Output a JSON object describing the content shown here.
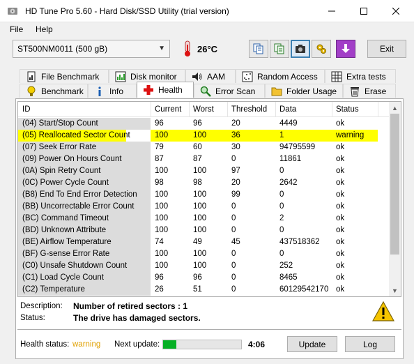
{
  "window": {
    "title": "HD Tune Pro 5.60 - Hard Disk/SSD Utility (trial version)"
  },
  "menu": {
    "file": "File",
    "help": "Help"
  },
  "toolbar": {
    "drive": "ST500NM0011 (500 gB)",
    "temperature": "26°C",
    "exit_label": "Exit",
    "icons": [
      "copy-info-icon",
      "copy-text-icon",
      "screenshot-icon",
      "options-icon",
      "download-icon"
    ]
  },
  "tabs_top": [
    {
      "label": "File Benchmark",
      "icon": "file-benchmark-icon"
    },
    {
      "label": "Disk monitor",
      "icon": "disk-monitor-icon"
    },
    {
      "label": "AAM",
      "icon": "speaker-icon"
    },
    {
      "label": "Random Access",
      "icon": "random-access-icon"
    },
    {
      "label": "Extra tests",
      "icon": "extra-tests-icon"
    }
  ],
  "tabs_bottom": [
    {
      "label": "Benchmark",
      "icon": "benchmark-icon"
    },
    {
      "label": "Info",
      "icon": "info-icon"
    },
    {
      "label": "Health",
      "icon": "health-icon",
      "selected": true
    },
    {
      "label": "Error Scan",
      "icon": "error-scan-icon"
    },
    {
      "label": "Folder Usage",
      "icon": "folder-icon"
    },
    {
      "label": "Erase",
      "icon": "erase-icon"
    }
  ],
  "table": {
    "columns": [
      "ID",
      "Current",
      "Worst",
      "Threshold",
      "Data",
      "Status"
    ],
    "rows": [
      {
        "id": "(04) Start/Stop Count",
        "current": "96",
        "worst": "96",
        "threshold": "20",
        "data": "4449",
        "status": "ok"
      },
      {
        "id": "(05) Reallocated Sector Count",
        "current": "100",
        "worst": "100",
        "threshold": "36",
        "data": "1",
        "status": "warning",
        "highlight": true
      },
      {
        "id": "(07) Seek Error Rate",
        "current": "79",
        "worst": "60",
        "threshold": "30",
        "data": "94795599",
        "status": "ok"
      },
      {
        "id": "(09) Power On Hours Count",
        "current": "87",
        "worst": "87",
        "threshold": "0",
        "data": "11861",
        "status": "ok"
      },
      {
        "id": "(0A) Spin Retry Count",
        "current": "100",
        "worst": "100",
        "threshold": "97",
        "data": "0",
        "status": "ok"
      },
      {
        "id": "(0C) Power Cycle Count",
        "current": "98",
        "worst": "98",
        "threshold": "20",
        "data": "2642",
        "status": "ok"
      },
      {
        "id": "(B8) End To End Error Detection",
        "current": "100",
        "worst": "100",
        "threshold": "99",
        "data": "0",
        "status": "ok"
      },
      {
        "id": "(BB) Uncorrectable Error Count",
        "current": "100",
        "worst": "100",
        "threshold": "0",
        "data": "0",
        "status": "ok"
      },
      {
        "id": "(BC) Command Timeout",
        "current": "100",
        "worst": "100",
        "threshold": "0",
        "data": "2",
        "status": "ok"
      },
      {
        "id": "(BD) Unknown Attribute",
        "current": "100",
        "worst": "100",
        "threshold": "0",
        "data": "0",
        "status": "ok"
      },
      {
        "id": "(BE) Airflow Temperature",
        "current": "74",
        "worst": "49",
        "threshold": "45",
        "data": "437518362",
        "status": "ok"
      },
      {
        "id": "(BF) G-sense Error Rate",
        "current": "100",
        "worst": "100",
        "threshold": "0",
        "data": "0",
        "status": "ok"
      },
      {
        "id": "(C0) Unsafe Shutdown Count",
        "current": "100",
        "worst": "100",
        "threshold": "0",
        "data": "252",
        "status": "ok"
      },
      {
        "id": "(C1) Load Cycle Count",
        "current": "96",
        "worst": "96",
        "threshold": "0",
        "data": "8465",
        "status": "ok"
      },
      {
        "id": "(C2) Temperature",
        "current": "26",
        "worst": "51",
        "threshold": "0",
        "data": "60129542170",
        "status": "ok"
      }
    ]
  },
  "description": {
    "label": "Description:",
    "value": "Number of retired sectors : 1",
    "status_label": "Status:",
    "status_value": "The drive has damaged sectors."
  },
  "footer": {
    "health_label": "Health status:",
    "health_value": "warning",
    "next_update_label": "Next update:",
    "progress": 0.17,
    "countdown": "4:06",
    "update_label": "Update",
    "log_label": "Log"
  },
  "colors": {
    "warning_highlight": "#ffff00",
    "warning_text": "#e0a000",
    "progress_fill": "#06b025"
  }
}
